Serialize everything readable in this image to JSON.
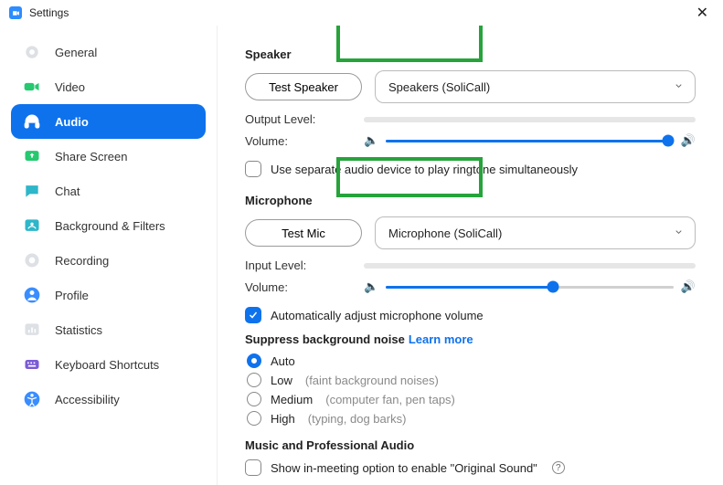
{
  "titlebar": {
    "title": "Settings"
  },
  "sidebar": {
    "items": [
      {
        "label": "General"
      },
      {
        "label": "Video"
      },
      {
        "label": "Audio"
      },
      {
        "label": "Share Screen"
      },
      {
        "label": "Chat"
      },
      {
        "label": "Background & Filters"
      },
      {
        "label": "Recording"
      },
      {
        "label": "Profile"
      },
      {
        "label": "Statistics"
      },
      {
        "label": "Keyboard Shortcuts"
      },
      {
        "label": "Accessibility"
      }
    ]
  },
  "speaker": {
    "title": "Speaker",
    "test_label": "Test Speaker",
    "device": "Speakers (SoliCall)",
    "output_level_label": "Output Level:",
    "volume_label": "Volume:",
    "separate_device_label": "Use separate audio device to play ringtone simultaneously"
  },
  "mic": {
    "title": "Microphone",
    "test_label": "Test Mic",
    "device": "Microphone (SoliCall)",
    "input_level_label": "Input Level:",
    "volume_label": "Volume:",
    "auto_adjust_label": "Automatically adjust microphone volume"
  },
  "suppress": {
    "title": "Suppress background noise",
    "learn_more": "Learn more",
    "options": [
      {
        "label": "Auto",
        "hint": ""
      },
      {
        "label": "Low",
        "hint": "(faint background noises)"
      },
      {
        "label": "Medium",
        "hint": "(computer fan, pen taps)"
      },
      {
        "label": "High",
        "hint": "(typing, dog barks)"
      }
    ]
  },
  "music": {
    "title": "Music and Professional Audio",
    "original_sound_label": "Show in-meeting option to enable \"Original Sound\""
  }
}
